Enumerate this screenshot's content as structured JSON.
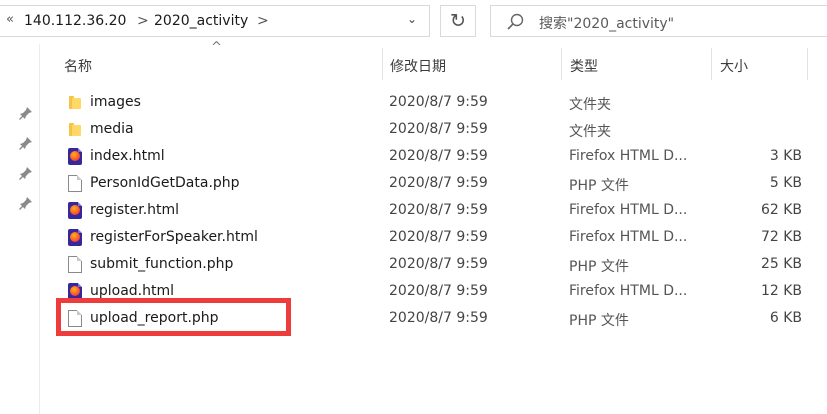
{
  "address_bar": {
    "back_chevron": "«",
    "crumbs": [
      "140.112.36.20",
      "2020_activity"
    ],
    "separator": ">",
    "dropdown": "⌄"
  },
  "refresh_glyph": "↻",
  "search": {
    "placeholder": "搜索\"2020_activity\""
  },
  "columns": {
    "name": "名称",
    "date": "修改日期",
    "type": "类型",
    "size": "大小",
    "sort_indicator": "^"
  },
  "files": [
    {
      "name": "images",
      "date": "2020/8/7 9:59",
      "type": "文件夹",
      "size": "",
      "icon": "folder-icon"
    },
    {
      "name": "media",
      "date": "2020/8/7 9:59",
      "type": "文件夹",
      "size": "",
      "icon": "folder-icon"
    },
    {
      "name": "index.html",
      "date": "2020/8/7 9:59",
      "type": "Firefox HTML D...",
      "size": "3 KB",
      "icon": "firefox-html-icon"
    },
    {
      "name": "PersonIdGetData.php",
      "date": "2020/8/7 9:59",
      "type": "PHP 文件",
      "size": "5 KB",
      "icon": "document-icon"
    },
    {
      "name": "register.html",
      "date": "2020/8/7 9:59",
      "type": "Firefox HTML D...",
      "size": "62 KB",
      "icon": "firefox-html-icon"
    },
    {
      "name": "registerForSpeaker.html",
      "date": "2020/8/7 9:59",
      "type": "Firefox HTML D...",
      "size": "72 KB",
      "icon": "firefox-html-icon"
    },
    {
      "name": "submit_function.php",
      "date": "2020/8/7 9:59",
      "type": "PHP 文件",
      "size": "25 KB",
      "icon": "document-icon"
    },
    {
      "name": "upload.html",
      "date": "2020/8/7 9:59",
      "type": "Firefox HTML D...",
      "size": "12 KB",
      "icon": "firefox-html-icon"
    },
    {
      "name": "upload_report.php",
      "date": "2020/8/7 9:59",
      "type": "PHP 文件",
      "size": "6 KB",
      "icon": "document-icon"
    }
  ],
  "colors": {
    "highlight": "#ee3b3b",
    "folder": "#ffd866",
    "firefox_bg": "#36279a"
  }
}
